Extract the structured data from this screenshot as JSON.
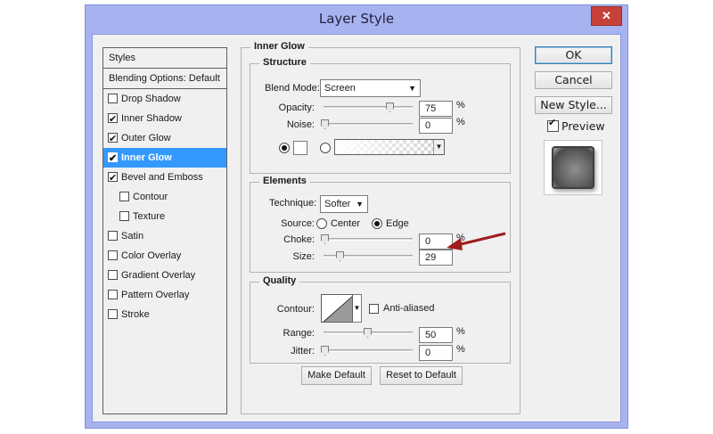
{
  "window": {
    "title": "Layer Style",
    "close_glyph": "✕"
  },
  "styles_panel": {
    "header": "Styles",
    "blending": "Blending Options: Default",
    "items": [
      {
        "label": "Drop Shadow",
        "checked": false,
        "selected": false,
        "indent": false
      },
      {
        "label": "Inner Shadow",
        "checked": true,
        "selected": false,
        "indent": false
      },
      {
        "label": "Outer Glow",
        "checked": true,
        "selected": false,
        "indent": false
      },
      {
        "label": "Inner Glow",
        "checked": true,
        "selected": true,
        "indent": false
      },
      {
        "label": "Bevel and Emboss",
        "checked": true,
        "selected": false,
        "indent": false
      },
      {
        "label": "Contour",
        "checked": false,
        "selected": false,
        "indent": true
      },
      {
        "label": "Texture",
        "checked": false,
        "selected": false,
        "indent": true
      },
      {
        "label": "Satin",
        "checked": false,
        "selected": false,
        "indent": false
      },
      {
        "label": "Color Overlay",
        "checked": false,
        "selected": false,
        "indent": false
      },
      {
        "label": "Gradient Overlay",
        "checked": false,
        "selected": false,
        "indent": false
      },
      {
        "label": "Pattern Overlay",
        "checked": false,
        "selected": false,
        "indent": false
      },
      {
        "label": "Stroke",
        "checked": false,
        "selected": false,
        "indent": false
      }
    ]
  },
  "inner_glow": {
    "title": "Inner Glow",
    "structure": {
      "title": "Structure",
      "blend_mode_label": "Blend Mode:",
      "blend_mode_value": "Screen",
      "opacity_label": "Opacity:",
      "opacity_value": "75",
      "noise_label": "Noise:",
      "noise_value": "0",
      "percent": "%"
    },
    "elements": {
      "title": "Elements",
      "technique_label": "Technique:",
      "technique_value": "Softer",
      "source_label": "Source:",
      "source_center": "Center",
      "source_edge": "Edge",
      "choke_label": "Choke:",
      "choke_value": "0",
      "size_label": "Size:",
      "size_value": "29",
      "percent": "%"
    },
    "quality": {
      "title": "Quality",
      "contour_label": "Contour:",
      "anti_aliased_label": "Anti-aliased",
      "range_label": "Range:",
      "range_value": "50",
      "jitter_label": "Jitter:",
      "jitter_value": "0",
      "percent": "%"
    },
    "make_default": "Make Default",
    "reset_default": "Reset to Default"
  },
  "actions": {
    "ok": "OK",
    "cancel": "Cancel",
    "new_style": "New Style...",
    "preview_label": "Preview",
    "preview_checked": true
  },
  "colors": {
    "selection": "#3399ff",
    "title_bar": "#a7b3f0",
    "annotation_arrow": "#a01c1c"
  }
}
